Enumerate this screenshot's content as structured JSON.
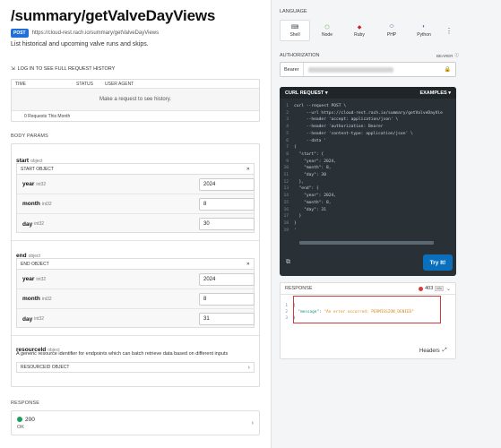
{
  "endpoint": {
    "title": "/summary/getValveDayViews",
    "method": "POST",
    "url": "https://cloud-rest.rach.io/summary/getValveDayViews",
    "description": "List historical and upcoming valve runs and skips."
  },
  "history": {
    "login_link": "LOG IN TO SEE FULL REQUEST HISTORY",
    "columns": [
      "TIME",
      "STATUS",
      "USER AGENT"
    ],
    "empty_text": "Make a request to see history.",
    "footer": "0 Requests This Month"
  },
  "body_params": {
    "label": "BODY PARAMS",
    "start": {
      "name": "start",
      "type": "object",
      "header": "START OBJECT",
      "fields": [
        {
          "name": "year",
          "type": "int32",
          "value": "2024"
        },
        {
          "name": "month",
          "type": "int32",
          "value": "8"
        },
        {
          "name": "day",
          "type": "int32",
          "value": "30"
        }
      ]
    },
    "end": {
      "name": "end",
      "type": "object",
      "header": "END OBJECT",
      "fields": [
        {
          "name": "year",
          "type": "int32",
          "value": "2024"
        },
        {
          "name": "month",
          "type": "int32",
          "value": "8"
        },
        {
          "name": "day",
          "type": "int32",
          "value": "31"
        }
      ]
    },
    "resource": {
      "name": "resourceId",
      "type": "object",
      "description": "A generic resource identifier for endpoints which can batch retrieve data based on different inputs",
      "header": "RESOURCEID OBJECT"
    }
  },
  "response_section": {
    "label": "RESPONSE",
    "status": "200",
    "status_text": "OK"
  },
  "language": {
    "label": "LANGUAGE",
    "items": [
      {
        "name": "Shell",
        "icon": "terminal-icon"
      },
      {
        "name": "Node",
        "icon": "node-icon"
      },
      {
        "name": "Ruby",
        "icon": "ruby-icon"
      },
      {
        "name": "PHP",
        "icon": "php-icon"
      },
      {
        "name": "Python",
        "icon": "python-icon"
      }
    ]
  },
  "authorization": {
    "label": "AUTHORIZATION",
    "type": "BEARER",
    "prefix": "Bearer"
  },
  "curl": {
    "label": "CURL REQUEST",
    "examples_label": "EXAMPLES",
    "try_label": "Try It!",
    "lines": [
      {
        "n": "1",
        "t": "curl --request POST \\"
      },
      {
        "n": "2",
        "t": "     --url https://cloud-rest.rach.io/summary/getValveDayVie"
      },
      {
        "n": "3",
        "t": "     --header 'accept: application/json' \\"
      },
      {
        "n": "4",
        "t": "     --header 'authorization: Bearer"
      },
      {
        "n": "5",
        "t": "     --header 'content-type: application/json' \\"
      },
      {
        "n": "6",
        "t": "     --data '"
      },
      {
        "n": "7",
        "t": "{"
      },
      {
        "n": "8",
        "t": "  \"start\": {"
      },
      {
        "n": "9",
        "t": "    \"year\": 2024,"
      },
      {
        "n": "10",
        "t": "    \"month\": 8,"
      },
      {
        "n": "11",
        "t": "    \"day\": 30"
      },
      {
        "n": "12",
        "t": "  },"
      },
      {
        "n": "13",
        "t": "  \"end\": {"
      },
      {
        "n": "14",
        "t": "    \"year\": 2024,"
      },
      {
        "n": "15",
        "t": "    \"month\": 8,"
      },
      {
        "n": "16",
        "t": "    \"day\": 31"
      },
      {
        "n": "17",
        "t": "  }"
      },
      {
        "n": "18",
        "t": "}"
      },
      {
        "n": "19",
        "t": "'"
      }
    ]
  },
  "response_panel": {
    "label": "RESPONSE",
    "status_code": "403",
    "info_tag": "info",
    "headers_label": "Headers",
    "lines": [
      {
        "n": "1",
        "t": "{"
      },
      {
        "n": "2",
        "k": "\"message\"",
        "v": "\"An error occurred: PERMISSION_DENIED\""
      },
      {
        "n": "3",
        "t": "}"
      }
    ]
  },
  "colors": {
    "accent": "#0a6fbd",
    "error": "#d23b3b",
    "success": "#1e9e5a",
    "code_bg": "#2a3136"
  }
}
